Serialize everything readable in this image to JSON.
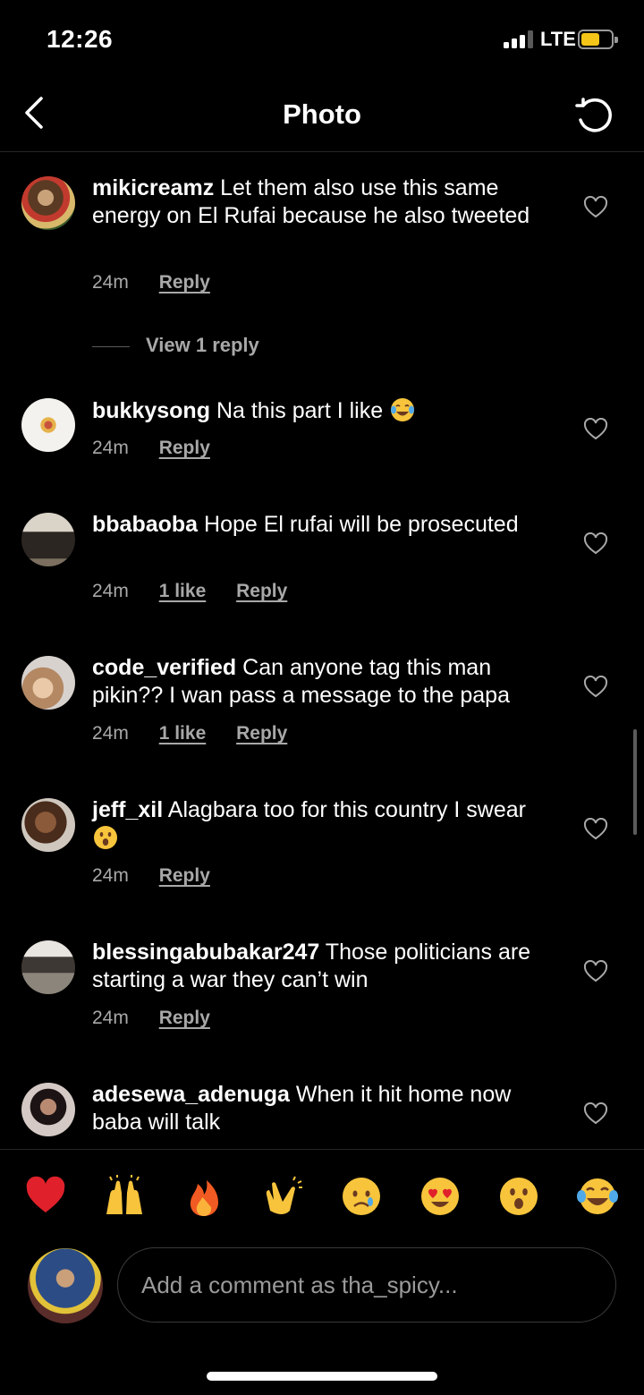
{
  "status_bar": {
    "time": "12:26",
    "network": "LTE"
  },
  "header": {
    "title": "Photo"
  },
  "comments": [
    {
      "username": "mikicreamz",
      "text": "Let them also use this same energy on El Rufai because he also tweeted",
      "time": "24m",
      "reply": "Reply",
      "view_replies": "View 1 reply"
    },
    {
      "username": "bukkysong",
      "text": "Na this part I like",
      "emoji": "face-with-tears-of-joy",
      "time": "24m",
      "reply": "Reply"
    },
    {
      "username": "bbabaoba",
      "text": "Hope El rufai will be prosecuted",
      "time": "24m",
      "likes": "1 like",
      "reply": "Reply"
    },
    {
      "username": "code_verified",
      "text": "Can anyone tag this man pikin?? I wan pass a message to the papa",
      "time": "24m",
      "likes": "1 like",
      "reply": "Reply"
    },
    {
      "username": "jeff_xil",
      "text": "Alagbara too for this country I swear",
      "emoji": "face-with-open-mouth",
      "time": "24m",
      "reply": "Reply"
    },
    {
      "username": "blessingabubakar247",
      "text": "Those politicians are starting a war they can’t win",
      "time": "24m",
      "reply": "Reply"
    },
    {
      "username": "adesewa_adenuga",
      "text": "When it hit home now baba will talk"
    }
  ],
  "reactions": [
    "red-heart",
    "raising-hands",
    "fire",
    "clapping-hands",
    "crying-face",
    "heart-eyes",
    "face-with-open-mouth",
    "face-with-tears-of-joy"
  ],
  "composer": {
    "placeholder": "Add a comment as tha_spicy..."
  },
  "colors": {
    "background": "#000000",
    "secondary_text": "#a8a8a8",
    "battery": "#f5c518"
  }
}
